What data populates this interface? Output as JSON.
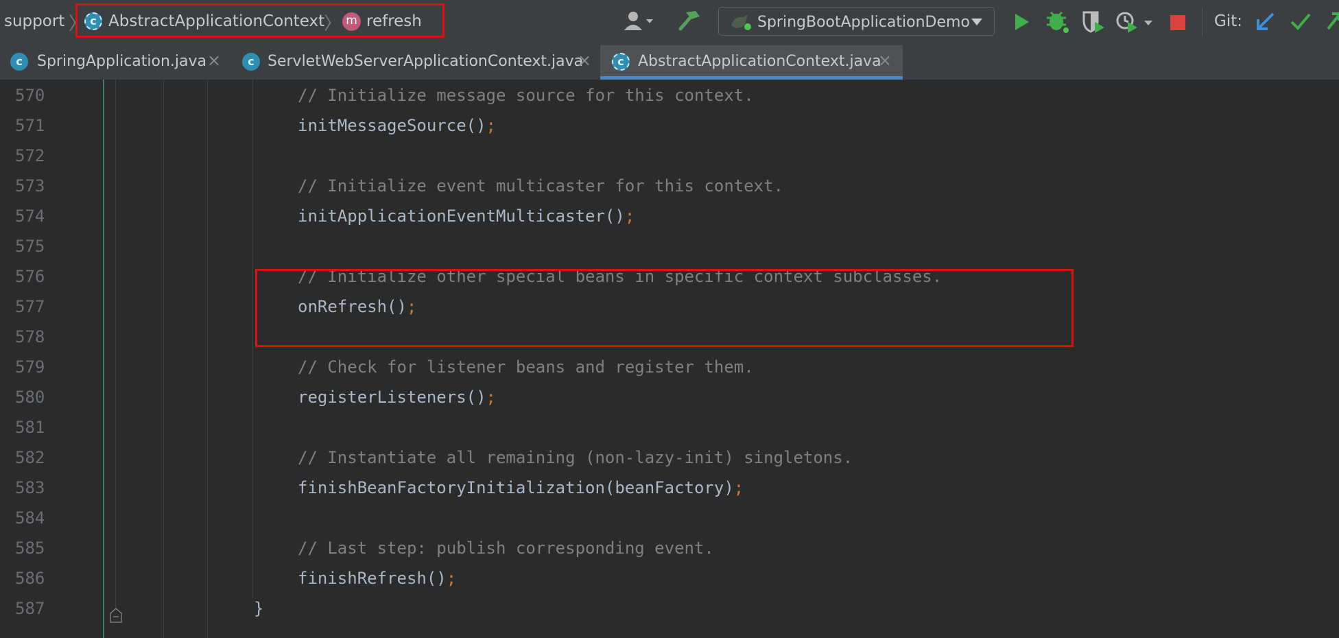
{
  "breadcrumb": {
    "package": "support",
    "class_name": "AbstractApplicationContext",
    "method_name": "refresh"
  },
  "toolbar": {
    "run_config": "SpringBootApplicationDemo",
    "git_label": "Git:",
    "icons": [
      "user-menu-icon",
      "build-hammer-icon",
      "run-icon",
      "debug-icon",
      "coverage-icon",
      "profile-icon",
      "stop-icon",
      "git-update-icon",
      "git-commit-icon",
      "git-push-icon"
    ]
  },
  "tabs": [
    {
      "label": "SpringApplication.java",
      "active": false
    },
    {
      "label": "ServletWebServerApplicationContext.java",
      "active": false
    },
    {
      "label": "AbstractApplicationContext.java",
      "active": true
    }
  ],
  "code_lines": [
    {
      "num": "570",
      "kind": "comment",
      "text": "// Initialize message source for this context."
    },
    {
      "num": "571",
      "kind": "call",
      "text": "initMessageSource()",
      "semi": ";"
    },
    {
      "num": "572",
      "kind": "blank",
      "text": ""
    },
    {
      "num": "573",
      "kind": "comment",
      "text": "// Initialize event multicaster for this context."
    },
    {
      "num": "574",
      "kind": "call",
      "text": "initApplicationEventMulticaster()",
      "semi": ";"
    },
    {
      "num": "575",
      "kind": "blank",
      "text": ""
    },
    {
      "num": "576",
      "kind": "comment",
      "text": "// Initialize other special beans in specific context subclasses."
    },
    {
      "num": "577",
      "kind": "call",
      "text": "onRefresh()",
      "semi": ";"
    },
    {
      "num": "578",
      "kind": "blank",
      "text": ""
    },
    {
      "num": "579",
      "kind": "comment",
      "text": "// Check for listener beans and register them."
    },
    {
      "num": "580",
      "kind": "call",
      "text": "registerListeners()",
      "semi": ";"
    },
    {
      "num": "581",
      "kind": "blank",
      "text": ""
    },
    {
      "num": "582",
      "kind": "comment",
      "text": "// Instantiate all remaining (non-lazy-init) singletons."
    },
    {
      "num": "583",
      "kind": "call",
      "text": "finishBeanFactoryInitialization(beanFactory)",
      "semi": ";"
    },
    {
      "num": "584",
      "kind": "blank",
      "text": ""
    },
    {
      "num": "585",
      "kind": "comment",
      "text": "// Last step: publish corresponding event."
    },
    {
      "num": "586",
      "kind": "call",
      "text": "finishRefresh()",
      "semi": ";"
    },
    {
      "num": "587",
      "kind": "brace",
      "text": "}"
    }
  ],
  "colors": {
    "editor_bg": "#2b2b2b",
    "comment": "#808080",
    "semicolon": "#cc7832",
    "highlight_box": "#e01010",
    "tab_underline": "#4a88c7"
  }
}
